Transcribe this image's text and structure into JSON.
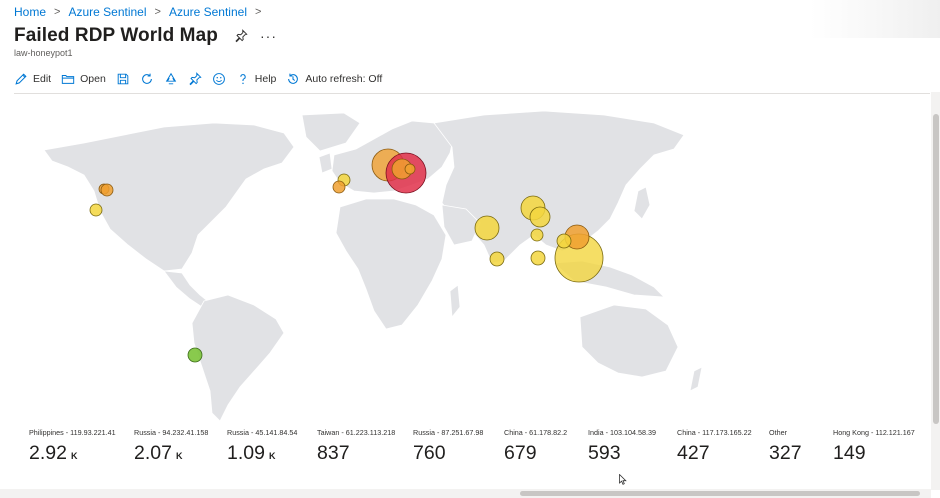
{
  "breadcrumb": [
    "Home",
    "Azure Sentinel",
    "Azure Sentinel"
  ],
  "title": "Failed RDP World Map",
  "subtitle": "law-honeypot1",
  "toolbar": {
    "edit": "Edit",
    "open": "Open",
    "help": "Help",
    "auto_refresh": "Auto refresh: Off"
  },
  "tiles": [
    {
      "label": "Philippines - 119.93.221.41",
      "value": "2.92",
      "unit": "K"
    },
    {
      "label": "Russia - 94.232.41.158",
      "value": "2.07",
      "unit": "K"
    },
    {
      "label": "Russia - 45.141.84.54",
      "value": "1.09",
      "unit": "K"
    },
    {
      "label": "Taiwan - 61.223.113.218",
      "value": "837",
      "unit": ""
    },
    {
      "label": "Russia - 87.251.67.98",
      "value": "760",
      "unit": ""
    },
    {
      "label": "China - 61.178.82.2",
      "value": "679",
      "unit": ""
    },
    {
      "label": "India - 103.104.58.39",
      "value": "593",
      "unit": ""
    },
    {
      "label": "China - 117.173.165.22",
      "value": "427",
      "unit": ""
    },
    {
      "label": "Other",
      "value": "327",
      "unit": ""
    },
    {
      "label": "Hong Kong - 112.121.167",
      "value": "149",
      "unit": ""
    }
  ],
  "colors": {
    "accent": "#0078d4",
    "land": "#e1e2e5",
    "bubble_yellow": "#f3d63e",
    "bubble_orange": "#f0a030",
    "bubble_red": "#e0304a",
    "bubble_green": "#7cc43a"
  }
}
